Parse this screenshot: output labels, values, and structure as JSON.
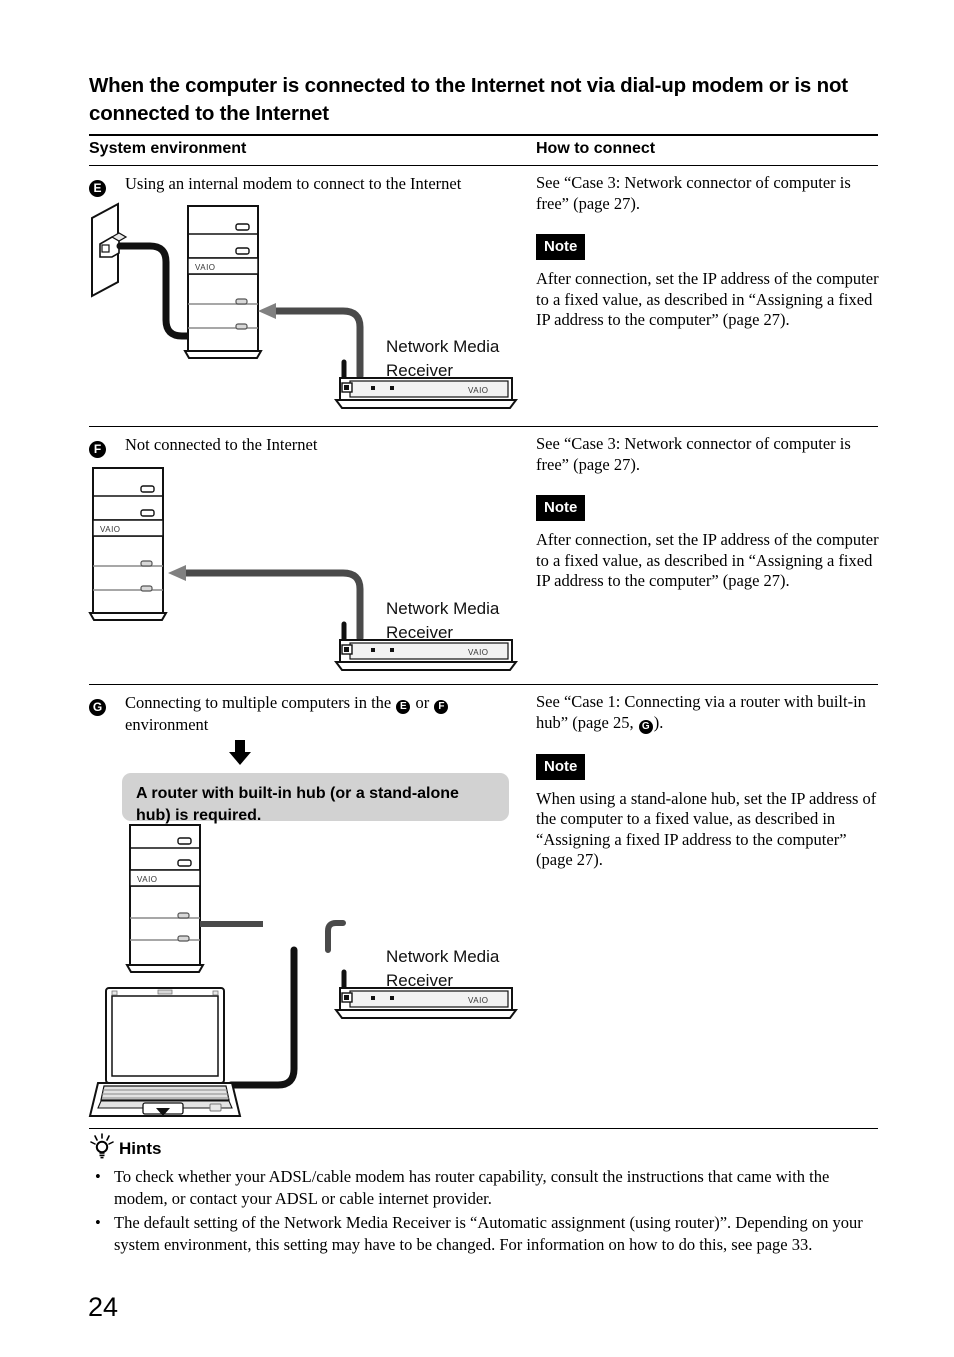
{
  "document": {
    "title": "When the computer is connected to the Internet not via dial-up modem or is not connected to the Internet",
    "page_number": "24"
  },
  "table": {
    "columns": {
      "left": "System environment",
      "right": "How to connect"
    },
    "rows": [
      {
        "marker": "E",
        "environment": "Using an internal modem to connect to the Internet",
        "connect_ref": "See “Case 3: Network connector of computer is free” (page 27).",
        "note_label": "Note",
        "note_body": "After connection, set the IP address of the computer to a fixed value, as described in “Assigning a fixed IP address to the computer” (page 27).",
        "device_label": "Network Media Receiver",
        "vaio_logo": "VAIO"
      },
      {
        "marker": "F",
        "environment": "Not connected to the Internet",
        "connect_ref": "See “Case 3: Network connector of computer is free” (page 27).",
        "note_label": "Note",
        "note_body": "After connection, set the IP address of the computer to a fixed value, as described in “Assigning a fixed IP address to the computer” (page 27).",
        "device_label": "Network Media Receiver",
        "vaio_logo": "VAIO"
      },
      {
        "marker": "G",
        "environment_part1": "Connecting to multiple computers in the",
        "environment_ref1": "E",
        "environment_mid": "or",
        "environment_ref2": "F",
        "environment_part2": "environment",
        "callout": "A router with built-in hub (or a stand-alone hub) is required.",
        "connect_ref_part1": "See “Case 1: Connecting via a router with built-in hub” (page 25,",
        "connect_ref_marker": "G",
        "connect_ref_part2": ").",
        "note_label": "Note",
        "note_body": "When using a stand-alone hub, set the IP address of the computer to a fixed value, as described in “Assigning a fixed IP address to the computer” (page 27).",
        "device_label": "Network Media Receiver",
        "vaio_logo": "VAIO"
      }
    ]
  },
  "hints": {
    "heading": "Hints",
    "icon": "lightbulb-icon",
    "bullet": "•",
    "items": [
      "To check whether your ADSL/cable modem has router capability, consult the instructions that came with the modem, or contact your ADSL or cable internet provider.",
      "The default setting of the Network Media Receiver is “Automatic assignment (using router)”. Depending on your system environment, this setting may have to be changed. For information on how to do this, see page 33."
    ]
  },
  "colors": {
    "cable": "#4a4a4a",
    "arrow_head": "#808080",
    "callout_bg": "#d2d2d2",
    "note_bg": "#000000",
    "line": "#000000"
  }
}
